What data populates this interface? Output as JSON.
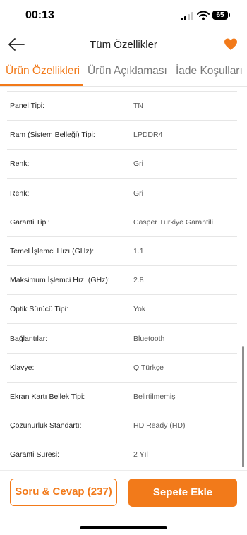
{
  "status_bar": {
    "time": "00:13",
    "battery": "65"
  },
  "header": {
    "title": "Tüm Özellikler"
  },
  "tabs": [
    {
      "label": "Ürün Özellikleri",
      "active": true
    },
    {
      "label": "Ürün Açıklaması",
      "active": false
    },
    {
      "label": "İade Koşulları",
      "active": false
    }
  ],
  "specs": [
    {
      "label": "Panel Tipi:",
      "value": "TN"
    },
    {
      "label": "Ram (Sistem Belleği) Tipi:",
      "value": "LPDDR4"
    },
    {
      "label": "Renk:",
      "value": "Gri"
    },
    {
      "label": "Renk:",
      "value": "Gri"
    },
    {
      "label": "Garanti Tipi:",
      "value": "Casper Türkiye Garantili"
    },
    {
      "label": "Temel İşlemci Hızı (GHz):",
      "value": "1.1"
    },
    {
      "label": "Maksimum İşlemci Hızı (GHz):",
      "value": "2.8"
    },
    {
      "label": "Optik Sürücü Tipi:",
      "value": "Yok"
    },
    {
      "label": "Bağlantılar:",
      "value": "Bluetooth"
    },
    {
      "label": "Klavye:",
      "value": "Q Türkçe"
    },
    {
      "label": "Ekran Kartı Bellek Tipi:",
      "value": "Belirtilmemiş"
    },
    {
      "label": "Çözünürlük Standartı:",
      "value": "HD Ready (HD)"
    },
    {
      "label": "Garanti Süresi:",
      "value": "2 Yıl"
    }
  ],
  "bottom_bar": {
    "qa_label": "Soru & Cevap (237)",
    "cart_label": "Sepete Ekle"
  },
  "colors": {
    "accent": "#f27a1a"
  },
  "icons": {
    "back": "arrow-left-icon",
    "favorite": "heart-icon"
  }
}
